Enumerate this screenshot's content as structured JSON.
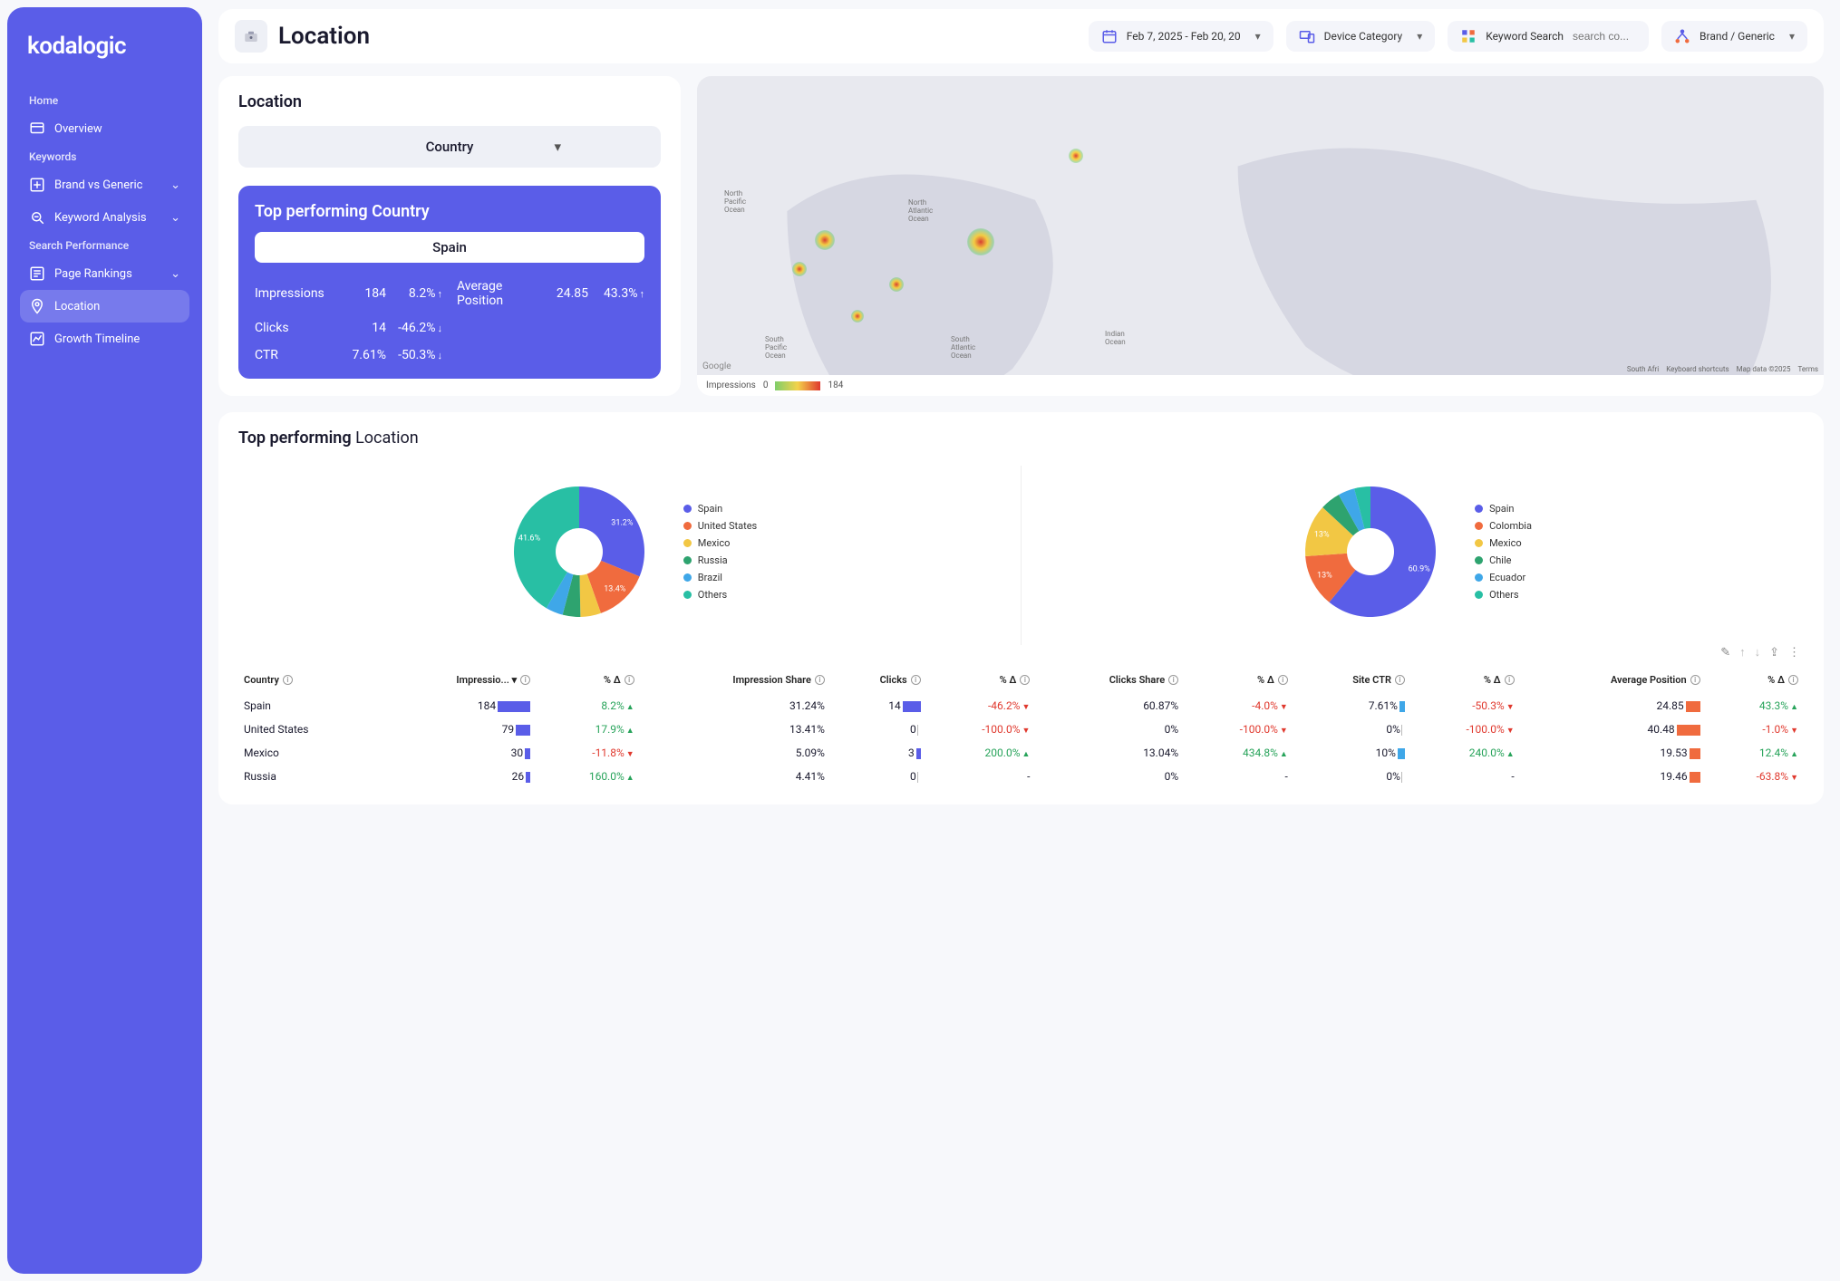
{
  "brand": "kodalogic",
  "header": {
    "title": "Location",
    "date_range": "Feb 7, 2025 - Feb 20, 20",
    "device_category_label": "Device Category",
    "keyword_search_label": "Keyword Search",
    "keyword_search_placeholder": "search co...",
    "brand_generic_label": "Brand / Generic"
  },
  "sidebar": {
    "sections": [
      {
        "label": "Home",
        "items": [
          {
            "label": "Overview",
            "icon": "overview"
          }
        ]
      },
      {
        "label": "Keywords",
        "items": [
          {
            "label": "Brand vs Generic",
            "icon": "brand-generic",
            "expandable": true
          },
          {
            "label": "Keyword Analysis",
            "icon": "keyword-analysis",
            "expandable": true
          }
        ]
      },
      {
        "label": "Search Performance",
        "items": [
          {
            "label": "Page Rankings",
            "icon": "page-rankings",
            "expandable": true
          },
          {
            "label": "Location",
            "icon": "location",
            "active": true
          },
          {
            "label": "Growth Timeline",
            "icon": "growth-timeline"
          }
        ]
      }
    ]
  },
  "location_card": {
    "title": "Location",
    "dimension_label": "Country",
    "top_title": "Top performing Country",
    "top_value": "Spain",
    "metrics": {
      "impressions": {
        "label": "Impressions",
        "value": "184",
        "pct": "8.2%",
        "dir": "up"
      },
      "clicks": {
        "label": "Clicks",
        "value": "14",
        "pct": "-46.2%",
        "dir": "down"
      },
      "ctr": {
        "label": "CTR",
        "value": "7.61%",
        "pct": "-50.3%",
        "dir": "down"
      },
      "avg_pos": {
        "label": "Average Position",
        "value": "24.85",
        "pct": "43.3%",
        "dir": "up"
      }
    }
  },
  "map": {
    "legend_label": "Impressions",
    "legend_min": "0",
    "legend_max": "184",
    "attrib": {
      "source": "South Afri",
      "shortcuts": "Keyboard shortcuts",
      "copyright": "Map data ©2025",
      "terms": "Terms"
    },
    "provider": "Google"
  },
  "charts_section": {
    "title_bold": "Top performing",
    "title_light": "Location"
  },
  "chart_data": [
    {
      "type": "pie",
      "metric": "Impressions share (%)",
      "series": [
        {
          "name": "Spain",
          "value": 31.2,
          "color": "#5a5de8"
        },
        {
          "name": "United States",
          "value": 13.4,
          "color": "#f06b3e"
        },
        {
          "name": "Mexico",
          "value": 5.1,
          "color": "#f2c744"
        },
        {
          "name": "Russia",
          "value": 4.4,
          "color": "#2ea36f"
        },
        {
          "name": "Brazil",
          "value": 4.3,
          "color": "#3fa7e8"
        },
        {
          "name": "Others",
          "value": 41.6,
          "color": "#28bfa4"
        }
      ],
      "visible_labels": [
        "31.2%",
        "13.4%",
        "41.6%"
      ]
    },
    {
      "type": "pie",
      "metric": "Clicks share (%)",
      "series": [
        {
          "name": "Spain",
          "value": 60.9,
          "color": "#5a5de8"
        },
        {
          "name": "Colombia",
          "value": 13.0,
          "color": "#f06b3e"
        },
        {
          "name": "Mexico",
          "value": 13.0,
          "color": "#f2c744"
        },
        {
          "name": "Chile",
          "value": 5.0,
          "color": "#2ea36f"
        },
        {
          "name": "Ecuador",
          "value": 4.1,
          "color": "#3fa7e8"
        },
        {
          "name": "Others",
          "value": 4.0,
          "color": "#28bfa4"
        }
      ],
      "visible_labels": [
        "60.9%",
        "13%",
        "13%"
      ]
    }
  ],
  "table": {
    "columns": [
      "Country",
      "Impressio...",
      "% Δ",
      "Impression Share",
      "Clicks",
      "% Δ",
      "Clicks Share",
      "% Δ",
      "Site CTR",
      "% Δ",
      "Average Position",
      "% Δ"
    ],
    "rows": [
      {
        "country": "Spain",
        "impr": "184",
        "impr_bar": 36,
        "impr_d": "8.2%",
        "impr_dir": "up",
        "share": "31.24%",
        "clicks": "14",
        "clk_bar": 20,
        "clk_d": "-46.2%",
        "clk_dir": "down",
        "clk_share": "60.87%",
        "clk_share_d": "-4.0%",
        "clk_share_dir": "down",
        "ctr": "7.61%",
        "ctr_bar": 6,
        "ctr_d": "-50.3%",
        "ctr_dir": "down",
        "avgp": "24.85",
        "avgp_bar": 16,
        "avgp_d": "43.3%",
        "avgp_dir": "up"
      },
      {
        "country": "United States",
        "impr": "79",
        "impr_bar": 16,
        "impr_d": "17.9%",
        "impr_dir": "up",
        "share": "13.41%",
        "clicks": "0",
        "clk_bar": 0,
        "clk_d": "-100.0%",
        "clk_dir": "down",
        "clk_share": "0%",
        "clk_share_d": "-100.0%",
        "clk_share_dir": "down",
        "ctr": "0%",
        "ctr_bar": 0,
        "ctr_d": "-100.0%",
        "ctr_dir": "down",
        "avgp": "40.48",
        "avgp_bar": 26,
        "avgp_d": "-1.0%",
        "avgp_dir": "down"
      },
      {
        "country": "Mexico",
        "impr": "30",
        "impr_bar": 6,
        "impr_d": "-11.8%",
        "impr_dir": "down",
        "share": "5.09%",
        "clicks": "3",
        "clk_bar": 5,
        "clk_d": "200.0%",
        "clk_dir": "up",
        "clk_share": "13.04%",
        "clk_share_d": "434.8%",
        "clk_share_dir": "up",
        "ctr": "10%",
        "ctr_bar": 8,
        "ctr_d": "240.0%",
        "ctr_dir": "up",
        "avgp": "19.53",
        "avgp_bar": 12,
        "avgp_d": "12.4%",
        "avgp_dir": "up"
      },
      {
        "country": "Russia",
        "impr": "26",
        "impr_bar": 5,
        "impr_d": "160.0%",
        "impr_dir": "up",
        "share": "4.41%",
        "clicks": "0",
        "clk_bar": 0,
        "clk_d": "-",
        "clk_dir": "none",
        "clk_share": "0%",
        "clk_share_d": "-",
        "clk_share_dir": "none",
        "ctr": "0%",
        "ctr_bar": 0,
        "ctr_d": "-",
        "ctr_dir": "none",
        "avgp": "19.46",
        "avgp_bar": 12,
        "avgp_d": "-63.8%",
        "avgp_dir": "down"
      }
    ]
  }
}
